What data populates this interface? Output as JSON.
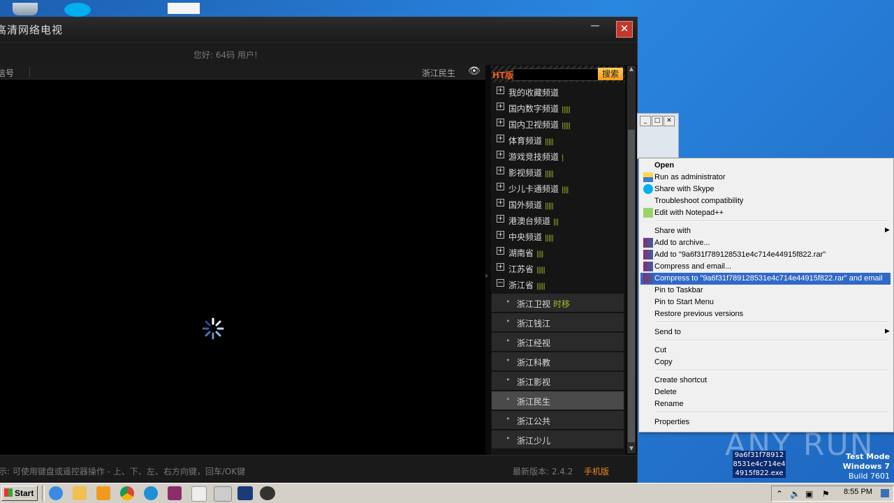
{
  "app": {
    "title": "高清网络电视",
    "greeting": "您好: 64码 用户!",
    "video_header_left": "信号",
    "video_header_channel": "浙江民生",
    "bottom_hint": "示: 可使用键盘或遥控器操作 - 上、下、左、右方向键，回车/OK键",
    "version_label": "最新版本: 2.4.2",
    "mobile_label": "手机版",
    "close_glyph": "✕"
  },
  "channel_panel": {
    "ht_label": "HT版",
    "search_button": "搜索",
    "categories": [
      {
        "label": "我的收藏频道",
        "bars": "",
        "expanded": false
      },
      {
        "label": "国内数字频道",
        "bars": "|||||",
        "expanded": false
      },
      {
        "label": "国内卫视频道",
        "bars": "|||||",
        "expanded": false
      },
      {
        "label": "体育频道",
        "bars": "|||||",
        "expanded": false
      },
      {
        "label": "游戏竞技频道",
        "bars": "|",
        "expanded": false
      },
      {
        "label": "影视频道",
        "bars": "|||||",
        "expanded": false
      },
      {
        "label": "少儿卡通频道",
        "bars": "||||",
        "expanded": false
      },
      {
        "label": "国外频道",
        "bars": "|||||",
        "expanded": false
      },
      {
        "label": "港澳台频道",
        "bars": "|||",
        "expanded": false
      },
      {
        "label": "中央频道",
        "bars": "|||||",
        "expanded": false
      },
      {
        "label": "湖南省",
        "bars": "||||",
        "expanded": false
      },
      {
        "label": "江苏省",
        "bars": "|||||",
        "expanded": false
      },
      {
        "label": "浙江省",
        "bars": "|||||",
        "expanded": true
      }
    ],
    "subchannels": [
      {
        "label": "浙江卫视",
        "tag": "时移"
      },
      {
        "label": "浙江钱江",
        "tag": ""
      },
      {
        "label": "浙江经视",
        "tag": ""
      },
      {
        "label": "浙江科教",
        "tag": ""
      },
      {
        "label": "浙江影视",
        "tag": ""
      },
      {
        "label": "浙江民生",
        "tag": ""
      },
      {
        "label": "浙江公共",
        "tag": ""
      },
      {
        "label": "浙江少儿",
        "tag": ""
      }
    ],
    "selected_subchannel": "浙江民生"
  },
  "context_menu": {
    "items": [
      {
        "label": "Open",
        "bold": true,
        "icon": "none"
      },
      {
        "label": "Run as administrator",
        "icon": "shield-icon"
      },
      {
        "label": "Share with Skype",
        "icon": "skype-icon"
      },
      {
        "label": "Troubleshoot compatibility",
        "icon": "none"
      },
      {
        "label": "Edit with Notepad++",
        "icon": "notepad-icon"
      },
      {
        "label": "Share with",
        "submenu": true,
        "icon": "none"
      },
      {
        "label": "Add to archive...",
        "icon": "winrar-icon"
      },
      {
        "label": "Add to \"9a6f31f789128531e4c714e44915f822.rar\"",
        "icon": "winrar-icon"
      },
      {
        "label": "Compress and email...",
        "icon": "winrar-icon"
      },
      {
        "label": "Compress to \"9a6f31f789128531e4c714e44915f822.rar\" and email",
        "icon": "winrar-icon",
        "highlighted": true
      },
      {
        "label": "Pin to Taskbar",
        "icon": "none"
      },
      {
        "label": "Pin to Start Menu",
        "icon": "none"
      },
      {
        "label": "Restore previous versions",
        "icon": "none"
      },
      {
        "label": "Send to",
        "submenu": true,
        "icon": "none"
      },
      {
        "label": "Cut",
        "icon": "none"
      },
      {
        "label": "Copy",
        "icon": "none"
      },
      {
        "label": "Create shortcut",
        "icon": "none"
      },
      {
        "label": "Delete",
        "icon": "none"
      },
      {
        "label": "Rename",
        "icon": "none"
      },
      {
        "label": "Properties",
        "icon": "none"
      }
    ]
  },
  "desktop": {
    "watermark": "ANY RUN",
    "exe_label": "9a6f31f78912 8531e4c714e4 4915f822.exe",
    "test_mode": [
      "Test Mode",
      "Windows 7",
      "Build 7601"
    ]
  },
  "taskbar": {
    "start_label": "Start",
    "clock": "8:55 PM"
  },
  "colors": {
    "accent_orange": "#f08a1c",
    "signal_green": "#9bbf2a",
    "menu_highlight": "#3169c6"
  }
}
